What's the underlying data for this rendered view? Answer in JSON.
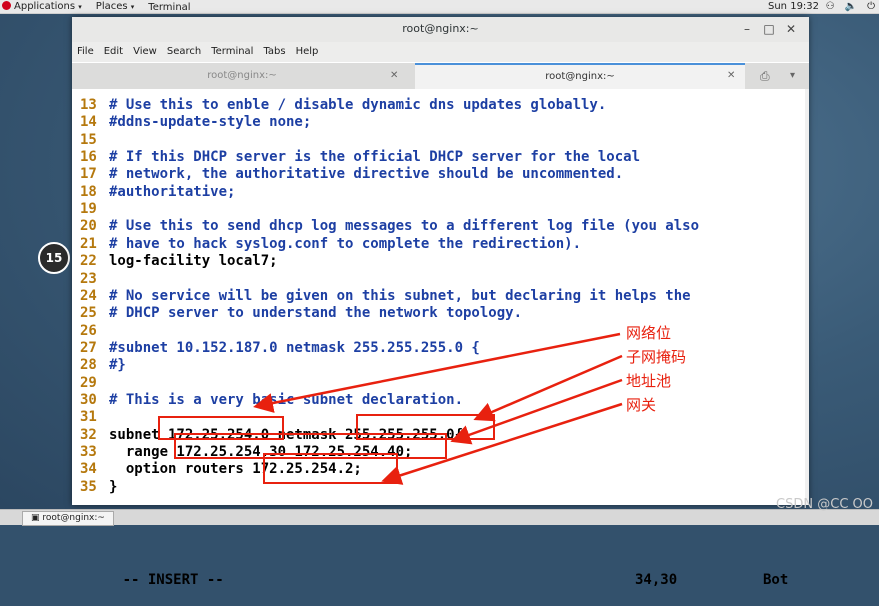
{
  "topbar": {
    "applications": "Applications",
    "places": "Places",
    "terminal": "Terminal",
    "clock": "Sun 19:32"
  },
  "window": {
    "title": "root@nginx:~",
    "menu": [
      "File",
      "Edit",
      "View",
      "Search",
      "Terminal",
      "Tabs",
      "Help"
    ],
    "tabs": [
      {
        "label": "root@nginx:~",
        "active": false
      },
      {
        "label": "root@nginx:~",
        "active": true
      }
    ]
  },
  "editor": {
    "lines": [
      {
        "num": "13",
        "text": "# Use this to enble / disable dynamic dns updates globally.",
        "comment": true
      },
      {
        "num": "14",
        "text": "#ddns-update-style none;",
        "comment": true
      },
      {
        "num": "15",
        "text": "",
        "comment": false
      },
      {
        "num": "16",
        "text": "# If this DHCP server is the official DHCP server for the local",
        "comment": true
      },
      {
        "num": "17",
        "text": "# network, the authoritative directive should be uncommented.",
        "comment": true
      },
      {
        "num": "18",
        "text": "#authoritative;",
        "comment": true
      },
      {
        "num": "19",
        "text": "",
        "comment": false
      },
      {
        "num": "20",
        "text": "# Use this to send dhcp log messages to a different log file (you also",
        "comment": true
      },
      {
        "num": "21",
        "text": "# have to hack syslog.conf to complete the redirection).",
        "comment": true
      },
      {
        "num": "22",
        "text": "log-facility local7;",
        "comment": false
      },
      {
        "num": "23",
        "text": "",
        "comment": false
      },
      {
        "num": "24",
        "text": "# No service will be given on this subnet, but declaring it helps the",
        "comment": true
      },
      {
        "num": "25",
        "text": "# DHCP server to understand the network topology.",
        "comment": true
      },
      {
        "num": "26",
        "text": "",
        "comment": false
      },
      {
        "num": "27",
        "text": "#subnet 10.152.187.0 netmask 255.255.255.0 {",
        "comment": true
      },
      {
        "num": "28",
        "text": "#}",
        "comment": true
      },
      {
        "num": "29",
        "text": "",
        "comment": false
      },
      {
        "num": "30",
        "text": "# This is a very basic subnet declaration.",
        "comment": true
      },
      {
        "num": "31",
        "text": "",
        "comment": false
      },
      {
        "num": "32",
        "text": "subnet 172.25.254.0 netmask 255.255.255.0{",
        "comment": false
      },
      {
        "num": "33",
        "text": "  range 172.25.254.30 172.25.254.40;",
        "comment": false
      },
      {
        "num": "34",
        "text": "  option routers 172.25.254.2;",
        "comment": false
      },
      {
        "num": "35",
        "text": "}",
        "comment": false
      }
    ],
    "mode": "-- INSERT --",
    "position": "34,30",
    "scroll": "Bot"
  },
  "annotations": [
    "网络位",
    "子网掩码",
    "地址池",
    "网关"
  ],
  "replay_badge": "15",
  "taskbar": {
    "item": "root@nginx:~"
  },
  "watermark": "CSDN @CC OO",
  "colors": {
    "annotation": "#e8210f",
    "comment": "#1d3fa3",
    "line_number": "#b5780d"
  }
}
